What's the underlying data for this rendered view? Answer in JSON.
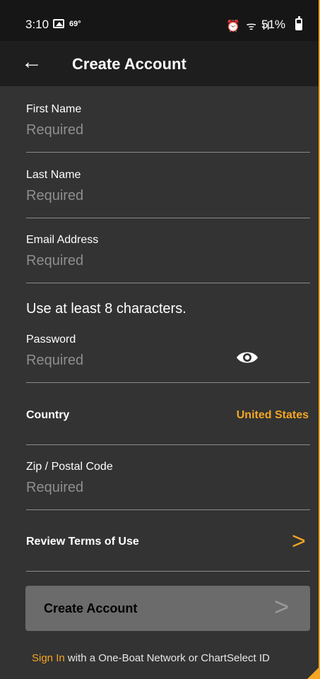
{
  "status_bar": {
    "time": "3:10",
    "temperature": "69°",
    "icons_text": "⏰ ᯤ ıl",
    "battery_percent": "51%"
  },
  "app_bar": {
    "title": "Create Account",
    "back_icon": "back-arrow-icon"
  },
  "form": {
    "first_name": {
      "label": "First Name",
      "placeholder": "Required"
    },
    "last_name": {
      "label": "Last Name",
      "placeholder": "Required"
    },
    "email": {
      "label": "Email Address",
      "placeholder": "Required"
    },
    "password_hint": "Use at least 8 characters.",
    "password": {
      "label": "Password",
      "placeholder": "Required"
    },
    "country": {
      "label": "Country",
      "value": "United States"
    },
    "zip": {
      "label": "Zip / Postal Code",
      "placeholder": "Required"
    },
    "terms": {
      "label": "Review Terms of Use",
      "chevron": ">"
    }
  },
  "create_button": {
    "label": "Create Account",
    "chevron": ">"
  },
  "footer": {
    "sign_in_link": "Sign In",
    "sign_in_rest": " with a One-Boat Network or ChartSelect ID"
  },
  "colors": {
    "accent": "#f5a623",
    "background": "#333333",
    "app_bar": "#1e1e1e",
    "disabled_button": "#6b6b6b"
  }
}
